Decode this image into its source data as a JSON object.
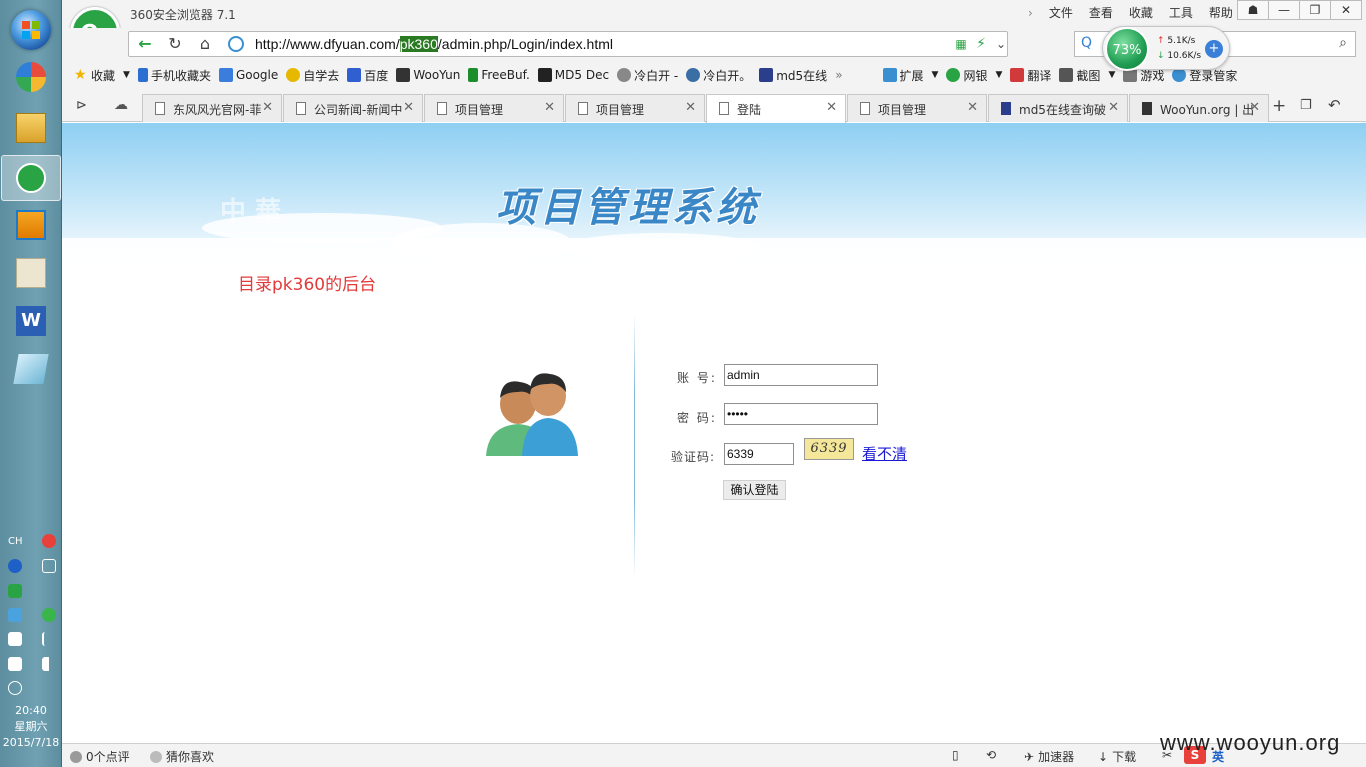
{
  "taskbar": {
    "clock_time": "20:40",
    "clock_weekday": "星期六",
    "clock_date": "2015/7/18",
    "lang": "CH"
  },
  "browser": {
    "title": "360安全浏览器 7.1",
    "menu": [
      "文件",
      "查看",
      "收藏",
      "工具",
      "帮助"
    ],
    "url_prefix": "http://www.dfyuan.com/",
    "url_selected": "pk360",
    "url_suffix": "/admin.php/Login/index.html",
    "speed_percent": "73%",
    "speed_up": "5.1K/s",
    "speed_down": "10.6K/s"
  },
  "favorites": [
    {
      "label": "收藏",
      "color": "#f0b400"
    },
    {
      "label": "手机收藏夹",
      "color": "#2b6fd1"
    },
    {
      "label": "Google",
      "color": "#3b7ddd"
    },
    {
      "label": "自学去",
      "color": "#e6b800"
    },
    {
      "label": "百度",
      "color": "#2f5fd0"
    },
    {
      "label": "WooYun",
      "color": "#333333"
    },
    {
      "label": "FreeBuf.",
      "color": "#1b8d2a"
    },
    {
      "label": "MD5 Dec",
      "color": "#222222"
    },
    {
      "label": "冷白开 -",
      "color": "#888888"
    },
    {
      "label": "冷白开。",
      "color": "#3b6ea5"
    },
    {
      "label": "md5在线",
      "color": "#2b3e8c"
    }
  ],
  "favorites_right": [
    {
      "label": "扩展",
      "color": "#3a8fd0"
    },
    {
      "label": "网银",
      "color": "#2aa345"
    },
    {
      "label": "翻译",
      "color": "#d03a3a"
    },
    {
      "label": "截图",
      "color": "#555555"
    },
    {
      "label": "游戏",
      "color": "#777777"
    },
    {
      "label": "登录管家",
      "color": "#3a8fd0"
    }
  ],
  "tabs": [
    {
      "label": "东风风光官网-菲"
    },
    {
      "label": "公司新闻-新闻中"
    },
    {
      "label": "项目管理"
    },
    {
      "label": "项目管理"
    },
    {
      "label": "登陆"
    },
    {
      "label": "项目管理"
    },
    {
      "label": "md5在线查询破"
    },
    {
      "label": "WooYun.org | 出"
    }
  ],
  "page": {
    "banner_title": "项目管理系统",
    "banner_faint": "中 華",
    "note": "目录pk360的后台",
    "account_label": "账  号:",
    "account_value": "admin",
    "password_label": "密  码:",
    "password_value": "•••••",
    "captcha_label": "验证码:",
    "captcha_value": "6339",
    "captcha_image_text": "6339",
    "refresh_link": "看不清",
    "submit_label": "确认登陆"
  },
  "statusbar": {
    "comments": "0个点评",
    "guess": "猜你喜欢",
    "accelerator": "加速器",
    "download": "下载",
    "ime": "英",
    "watermark": "www.wooyun.org"
  },
  "colors": {
    "accent_green": "#2aa345",
    "note_red": "#e23a3a",
    "link_blue": "#1a1ad6",
    "banner_blue": "#3a87c7"
  }
}
